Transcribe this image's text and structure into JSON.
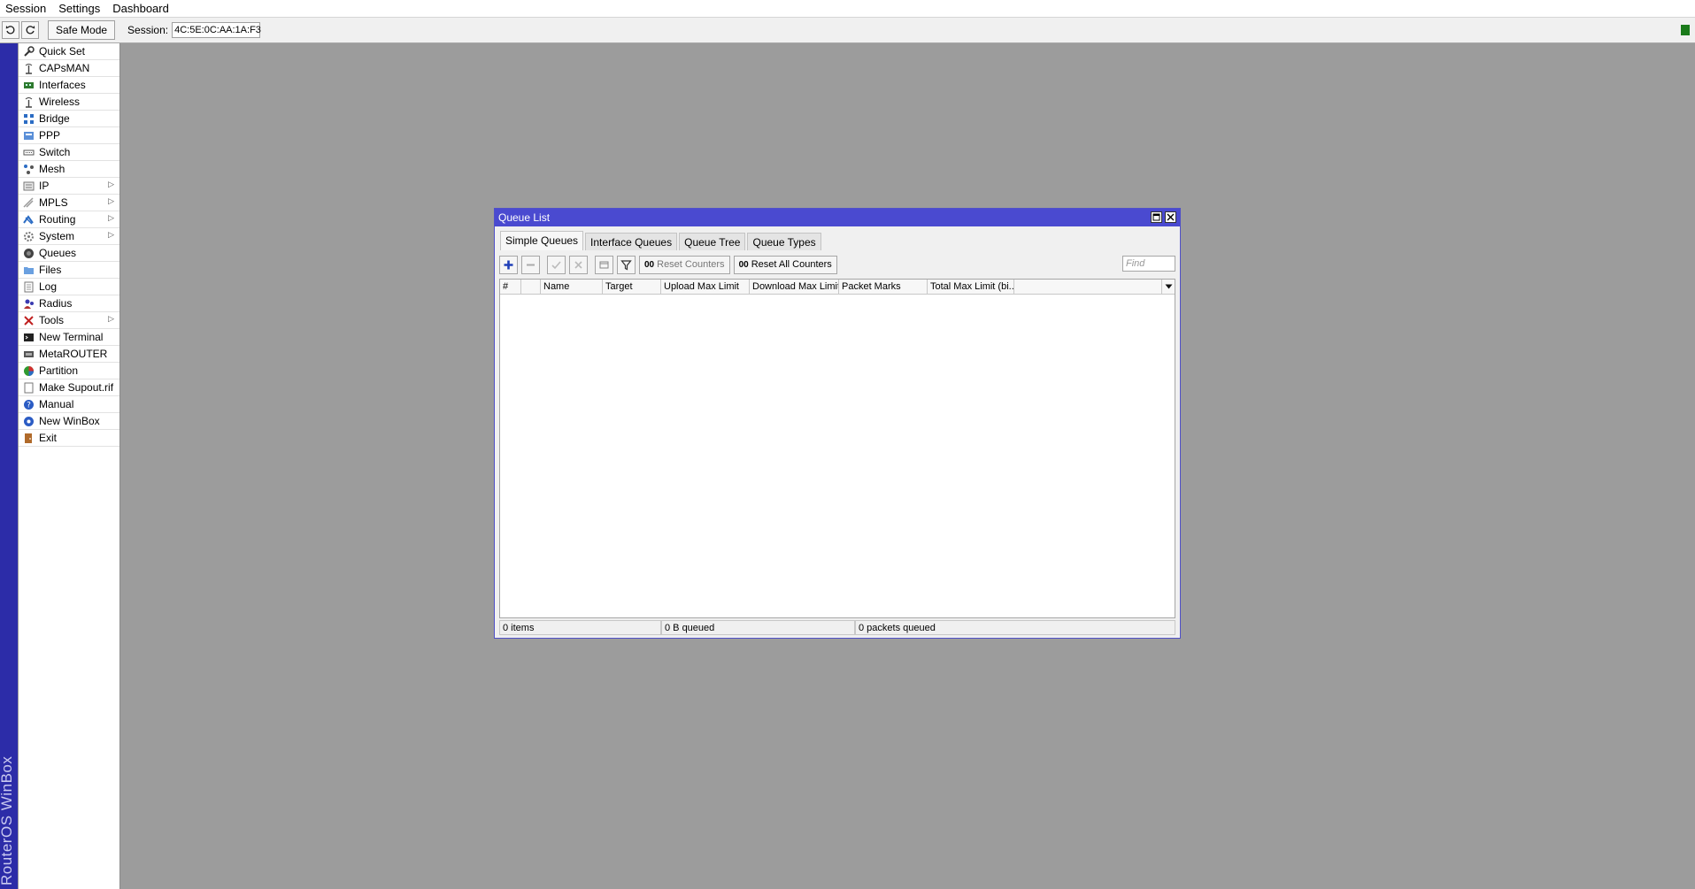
{
  "menu": [
    "Session",
    "Settings",
    "Dashboard"
  ],
  "toolbar": {
    "undo_icon": "undo-icon",
    "redo_icon": "redo-icon",
    "safe_mode": "Safe Mode",
    "session_label": "Session:",
    "session_value": "4C:5E:0C:AA:1A:F3",
    "status_color": "#1a7a1a"
  },
  "brand": "RouterOS WinBox",
  "sidebar": {
    "items": [
      {
        "label": "Quick Set",
        "icon": "quick-set-icon",
        "submenu": false
      },
      {
        "label": "CAPsMAN",
        "icon": "capsman-icon",
        "submenu": false
      },
      {
        "label": "Interfaces",
        "icon": "interfaces-icon",
        "submenu": false
      },
      {
        "label": "Wireless",
        "icon": "wireless-icon",
        "submenu": false
      },
      {
        "label": "Bridge",
        "icon": "bridge-icon",
        "submenu": false
      },
      {
        "label": "PPP",
        "icon": "ppp-icon",
        "submenu": false
      },
      {
        "label": "Switch",
        "icon": "switch-icon",
        "submenu": false
      },
      {
        "label": "Mesh",
        "icon": "mesh-icon",
        "submenu": false
      },
      {
        "label": "IP",
        "icon": "ip-icon",
        "submenu": true
      },
      {
        "label": "MPLS",
        "icon": "mpls-icon",
        "submenu": true
      },
      {
        "label": "Routing",
        "icon": "routing-icon",
        "submenu": true
      },
      {
        "label": "System",
        "icon": "system-icon",
        "submenu": true
      },
      {
        "label": "Queues",
        "icon": "queues-icon",
        "submenu": false
      },
      {
        "label": "Files",
        "icon": "files-icon",
        "submenu": false
      },
      {
        "label": "Log",
        "icon": "log-icon",
        "submenu": false
      },
      {
        "label": "Radius",
        "icon": "radius-icon",
        "submenu": false
      },
      {
        "label": "Tools",
        "icon": "tools-icon",
        "submenu": true
      },
      {
        "label": "New Terminal",
        "icon": "terminal-icon",
        "submenu": false
      },
      {
        "label": "MetaROUTER",
        "icon": "metarouter-icon",
        "submenu": false
      },
      {
        "label": "Partition",
        "icon": "partition-icon",
        "submenu": false
      },
      {
        "label": "Make Supout.rif",
        "icon": "supout-icon",
        "submenu": false
      },
      {
        "label": "Manual",
        "icon": "manual-icon",
        "submenu": false
      },
      {
        "label": "New WinBox",
        "icon": "winbox-icon",
        "submenu": false
      },
      {
        "label": "Exit",
        "icon": "exit-icon",
        "submenu": false
      }
    ]
  },
  "window": {
    "title": "Queue List",
    "tabs": [
      {
        "label": "Simple Queues",
        "active": true
      },
      {
        "label": "Interface Queues",
        "active": false
      },
      {
        "label": "Queue Tree",
        "active": false
      },
      {
        "label": "Queue Types",
        "active": false
      }
    ],
    "reset_counters": "Reset Counters",
    "reset_all_counters": "Reset All Counters",
    "counter_prefix": "00",
    "find_placeholder": "Find",
    "columns": [
      "#",
      "",
      "Name",
      "Target",
      "Upload Max Limit",
      "Download Max Limit",
      "Packet Marks",
      "Total Max Limit (bi..."
    ],
    "status": {
      "items": "0 items",
      "queued_bytes": "0 B queued",
      "queued_packets": "0 packets queued"
    },
    "accent": "#4a4ad0"
  }
}
